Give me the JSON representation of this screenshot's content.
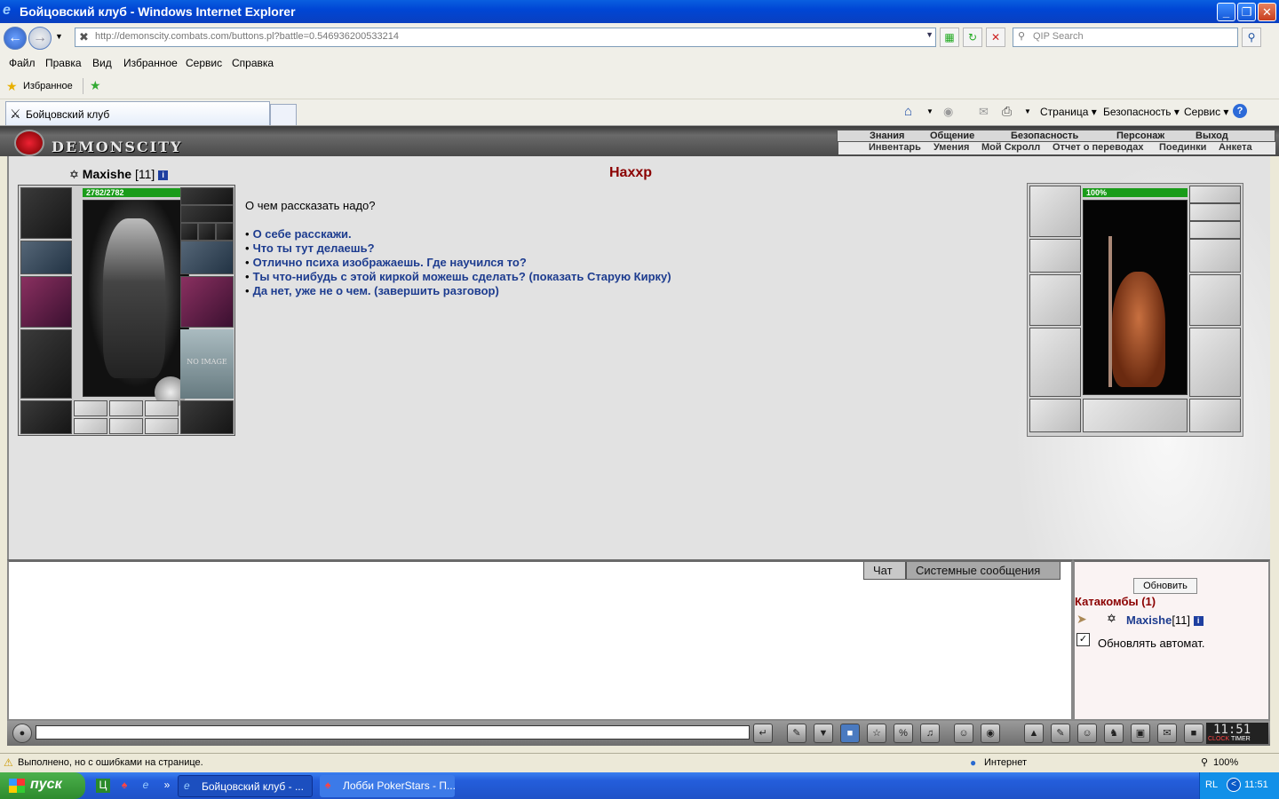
{
  "window": {
    "title": "Бойцовский клуб - Windows Internet Explorer",
    "controls": [
      "_",
      "❐",
      "✕"
    ]
  },
  "browser": {
    "address": "http://demonscity.combats.com/buttons.pl?battle=0.546936200533214",
    "search_placeholder": "QIP Search",
    "menu": [
      "Файл",
      "Правка",
      "Вид",
      "Избранное",
      "Сервис",
      "Справка"
    ],
    "favorites_label": "Избранное",
    "tab_title": "Бойцовский клуб",
    "commands": [
      "Страница",
      "Безопасность",
      "Сервис"
    ]
  },
  "game": {
    "logo": "DEMONSCITY",
    "top_nav": [
      "Знания",
      "Общение",
      "Безопасность",
      "Персонаж",
      "Выход"
    ],
    "sub_nav": [
      "Инвентарь",
      "Умения",
      "Мой Скролл",
      "Отчет о переводах",
      "Поединки",
      "Анкета"
    ],
    "player": {
      "name": "Maxishe",
      "level": "[11]",
      "hp_text": "2782/2782",
      "hp_fraction": 1.0,
      "no_image_text": "NO IMAGE"
    },
    "npc": {
      "name": "Нахxр",
      "hp_text": "100%",
      "hp_fraction": 1.0
    },
    "dialog": {
      "question": "О чем рассказать надо?",
      "bullet": "•",
      "options": [
        "О себе расскажи.",
        "Что ты тут делаешь?",
        "Отлично психа изображаешь. Где научился то?",
        "Ты что-нибудь с этой киркой можешь сделать? (показать Старую Кирку)",
        "Да нет, уже не о чем. (завершить разговор)"
      ]
    },
    "chat_tabs": [
      "Чат",
      "Системные сообщения"
    ],
    "room": {
      "refresh_label": "Обновить",
      "location": "Катакомбы (1)",
      "user_name": "Maxishe",
      "user_level": "[11]",
      "auto_refresh_label": "Обновлять автомат.",
      "auto_refresh_checked": true
    },
    "clock": {
      "time": "11:51",
      "labels": [
        "CLOCK",
        "TIMER"
      ]
    }
  },
  "status": {
    "message": "Выполнено, но с ошибками на странице.",
    "zone": "Интернет",
    "zoom": "100%"
  },
  "taskbar": {
    "start_label": "пуск",
    "tasks": [
      "Бойцовский клуб - ...",
      "Лобби PokerStars - П..."
    ],
    "language": "RL",
    "time": "11:51"
  },
  "colors": {
    "npc_name": "#8b0000",
    "dialog_link": "#1d3c8f",
    "hp_bar": "#1a9c1a"
  }
}
